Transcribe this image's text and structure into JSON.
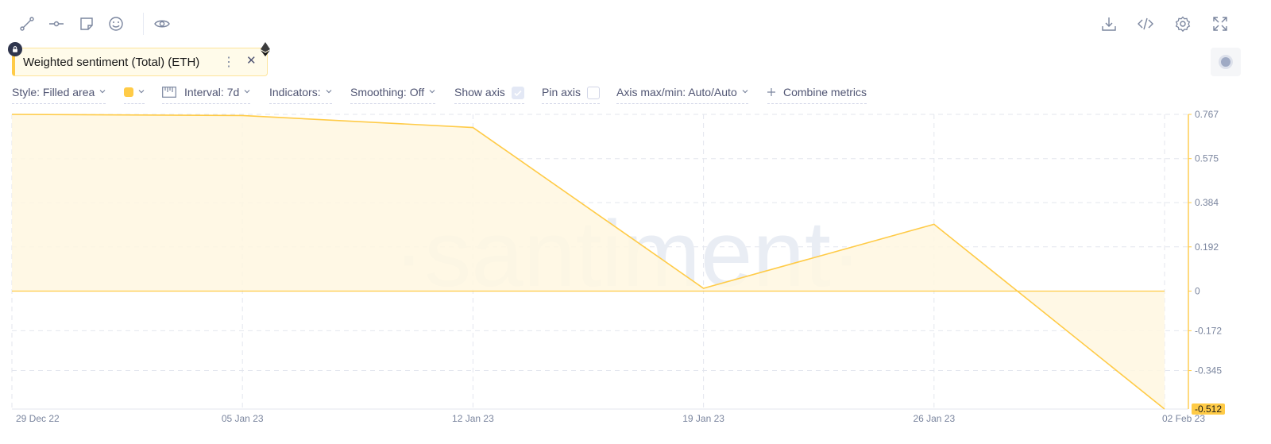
{
  "toolbar": {
    "left_icons": [
      "line-draw-icon",
      "horizontal-ray-icon",
      "sticky-note-icon",
      "emoji-icon",
      "eye-icon"
    ],
    "right_icons": [
      "download-icon",
      "embed-code-icon",
      "settings-icon",
      "fullscreen-icon"
    ]
  },
  "metric": {
    "label": "Weighted sentiment (Total) (ETH)",
    "menu_glyph": "⋮",
    "close_glyph": "✕"
  },
  "settings": {
    "style": "Style: Filled area",
    "interval": "Interval: 7d",
    "indicators": "Indicators:",
    "smoothing": "Smoothing: Off",
    "show_axis": "Show axis",
    "show_axis_checked": true,
    "pin_axis": "Pin axis",
    "pin_axis_checked": false,
    "axis_maxmin": "Axis max/min: Auto/Auto",
    "combine": "Combine metrics",
    "metric_color": "#ffcb47"
  },
  "chart_data": {
    "type": "area",
    "x": [
      "29 Dec 22",
      "05 Jan 23",
      "12 Jan 23",
      "19 Jan 23",
      "26 Jan 23",
      "02 Feb 23"
    ],
    "x_tick_labels": [
      "29 Dec 22",
      "05 Jan 23",
      "12 Jan 23",
      "19 Jan 23",
      "26 Jan 23",
      "02 Feb 23"
    ],
    "series": [
      {
        "values": [
          0.767,
          0.762,
          0.71,
          0.012,
          0.29,
          -0.512
        ],
        "color": "#ffcb47",
        "fill": "#fff7e1"
      }
    ],
    "y_tick_labels": [
      "0.767",
      "0.575",
      "0.384",
      "0.192",
      "0",
      "-0.172",
      "-0.345"
    ],
    "y_ticks": [
      0.767,
      0.575,
      0.384,
      0.192,
      0,
      -0.172,
      -0.345
    ],
    "ylim": [
      -0.512,
      0.767
    ],
    "last_value_label": "-0.512",
    "watermark": "·santiment·",
    "grid": true,
    "axis_side": "right"
  }
}
